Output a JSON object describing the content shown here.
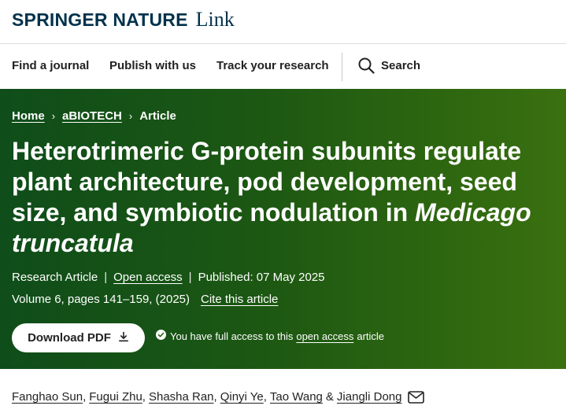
{
  "brand": {
    "name": "SPRINGER NATURE",
    "product": "Link"
  },
  "nav": {
    "find_journal": "Find a journal",
    "publish": "Publish with us",
    "track": "Track your research",
    "search": "Search"
  },
  "breadcrumb": {
    "home": "Home",
    "journal": "aBIOTECH",
    "current": "Article",
    "separator": "›"
  },
  "article": {
    "title_main": "Heterotrimeric G-protein subunits regulate plant architecture, pod development, seed size, and symbiotic nodulation in ",
    "title_species": "Medicago truncatula",
    "type": "Research Article",
    "access": "Open access",
    "published": "Published: 07 May 2025",
    "volume": "Volume 6, pages 141–159, (2025)",
    "cite": "Cite this article",
    "download_pdf": "Download PDF",
    "access_note_prefix": "You have full access to this",
    "access_note_link": "open access",
    "access_note_suffix": "article"
  },
  "authors": [
    "Fanghao Sun",
    "Fugui Zhu",
    "Shasha Ran",
    "Qinyi Ye",
    "Tao Wang",
    "Jiangli Dong"
  ],
  "author_separators": {
    "comma": ",",
    "and": "&"
  },
  "colors": {
    "brand_navy": "#01324b",
    "hero_green_dark": "#0f4d1a",
    "hero_green_light": "#3a7010"
  },
  "icons": [
    "search-icon",
    "chevron-right-icon",
    "download-icon",
    "check-circle-icon",
    "mail-icon"
  ]
}
